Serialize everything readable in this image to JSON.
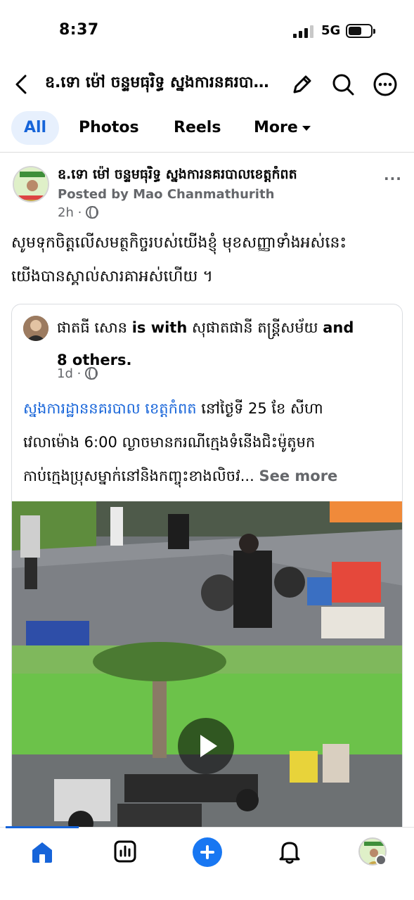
{
  "status_bar": {
    "time": "8:37",
    "network": "5G",
    "battery_level": 0.6
  },
  "top_nav": {
    "page_name": "ឧ.ទោ ម៉ៅ ចន្ទមធុរិទ្ធ ស្នងការនគរបាលខេត្តកំពត",
    "back_icon": "chevron-left-icon",
    "edit_icon": "pencil-icon",
    "search_icon": "search-icon",
    "more_icon": "more-horizontal-circle-icon"
  },
  "tabs": [
    {
      "label": "All",
      "active": true
    },
    {
      "label": "Photos",
      "active": false
    },
    {
      "label": "Reels",
      "active": false
    },
    {
      "label": "More",
      "active": false
    }
  ],
  "post": {
    "author": "ឧ.ទោ ម៉ៅ ចន្ទមធុរិទ្ធ ស្នងការនគរបាលខេត្តកំពត",
    "byline": "Posted by Mao Chanmathurith",
    "time": "2h",
    "more_label": "···",
    "text_line1": "សូមទុកចិត្តលើសមត្ថកិច្ចរបស់យើងខ្ញុំ មុខសញ្ញាទាំងអស់នេះ",
    "text_line2": "យើងបានស្គាល់សារគាអស់ហើយ ។"
  },
  "shared_post": {
    "author": "ផាតធី សោន",
    "with_text": "is with",
    "tagged": "សុផាតផានី តន្ត្រីសម័យ",
    "and_text": "and",
    "others": "8 others.",
    "time": "1d",
    "link_text": "ស្នងការដ្ឋាននគរបាល ខេត្តកំពត",
    "text_line1_rest": " នៅថ្ងៃទី 25 ខែ សីហា",
    "text_line2": "វេលាម៉ោង 6:00 ល្ងាចមានករណីក្មេងទំនើងជិះម៉ូតូមក",
    "text_line3": "កាប់ក្មេងប្រុសម្នាក់នៅនិងកញ្ចុះខាងលិចវ...",
    "see_more": "See more"
  },
  "bottom_nav": {
    "items": [
      "home-icon",
      "dashboard-icon",
      "create-icon",
      "notifications-icon",
      "profile-avatar"
    ],
    "active": "home-icon"
  },
  "colors": {
    "accent": "#1664d9",
    "secondary_text": "#65676b",
    "tab_active_bg": "#e7f0fd"
  }
}
